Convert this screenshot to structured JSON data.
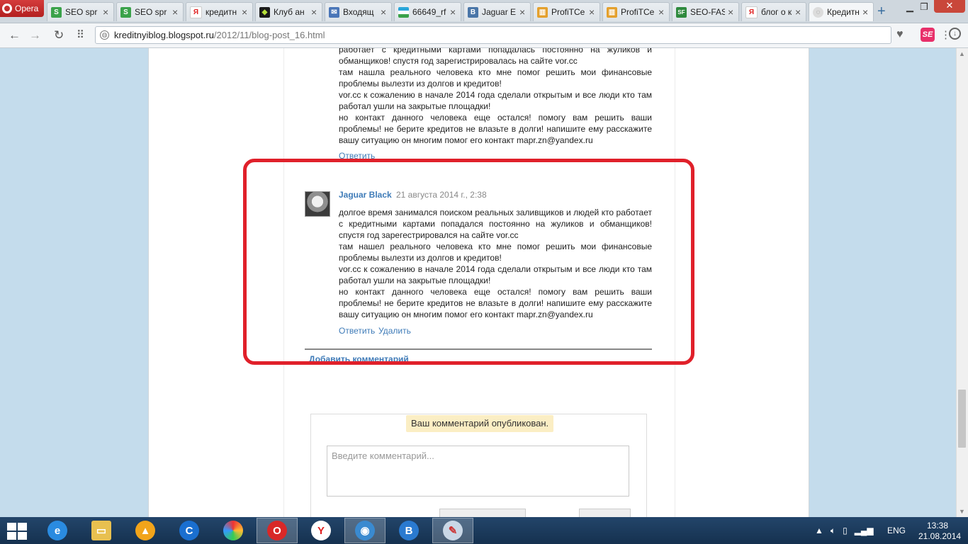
{
  "browser": {
    "menu_label": "Opera",
    "tabs": [
      {
        "label": "SEO spr",
        "icon": "seo-sprint-icon",
        "color": "#3aa24a",
        "glyph": "S"
      },
      {
        "label": "SEO spr",
        "icon": "seo-sprint-icon",
        "color": "#3aa24a",
        "glyph": "S"
      },
      {
        "label": "кредитн",
        "icon": "yandex-icon",
        "color": "#ffffff",
        "glyph": "Я"
      },
      {
        "label": "Клуб ан",
        "icon": "club-icon",
        "color": "#1a1a1a",
        "glyph": "◆"
      },
      {
        "label": "Входящ",
        "icon": "mail-icon",
        "color": "#4a76b8",
        "glyph": "✉"
      },
      {
        "label": "66649_rf",
        "icon": "uzbek-flag-icon",
        "color": "#2aa6d9",
        "glyph": "≡"
      },
      {
        "label": "Jaguar E",
        "icon": "vk-icon",
        "color": "#4a76a8",
        "glyph": "B"
      },
      {
        "label": "ProfiTCe",
        "icon": "profitcentr-icon",
        "color": "#e4a02d",
        "glyph": "▥"
      },
      {
        "label": "ProfiTCe",
        "icon": "profitcentr-icon",
        "color": "#e4a02d",
        "glyph": "▥"
      },
      {
        "label": "SEO-FAS",
        "icon": "seo-fast-icon",
        "color": "#2f8a3e",
        "glyph": "SF"
      },
      {
        "label": "блог о к",
        "icon": "yandex-icon",
        "color": "#ffffff",
        "glyph": "Я"
      },
      {
        "label": "Кредитн",
        "icon": "blogger-icon",
        "color": "#dcdcdc",
        "glyph": "◌"
      }
    ],
    "new_tab": "+",
    "url_host": "kreditnyiblog.blogspot.ru",
    "url_path": "/2012/11/blog-post_16.html"
  },
  "previous_comment": {
    "lines": [
      "работает с кредитными картами попадалась постоянно на жуликов и обманщиков! спустя год зарегистрировалась на сайте vor.cc",
      "там нашла реального человека кто мне помог решить мои финансовые проблемы вылезти из долгов и кредитов!",
      "vor.cc к сожалению в начале 2014 года сделали открытым и все люди кто там работал ушли на закрытые площадки!",
      "но контакт данного человека еще остался! помогу вам решить ваши проблемы! не берите кредитов не влазьте в долги! напишите ему расскажите вашу ситуацию он многим помог его контакт mapr.zn@yandex.ru"
    ],
    "reply": "Ответить"
  },
  "comment": {
    "author": "Jaguar Black",
    "date": "21 августа 2014 г., 2:38",
    "lines": [
      "долгое время занимался поиском реальных заливщиков и людей кто работает с кредитными картами попадался постоянно на жуликов и обманщиков! спустя год зарегестрировался на сайте vor.cc",
      "там нашел реального человека кто мне помог решить мои финансовые проблемы вылезти из долгов и кредитов!",
      "vor.cc к сожалению в начале 2014 года сделали открытым и все люди кто там работал ушли на закрытые площадки!",
      "но контакт данного человека еще остался! помогу вам решить ваши проблемы! не берите кредитов не влазьте в долги! напишите ему расскажите вашу ситуацию он многим помог его контакт mapr.zn@yandex.ru"
    ],
    "reply": "Ответить",
    "delete": "Удалить"
  },
  "add_comment": "Добавить комментарий",
  "form": {
    "notice": "Ваш комментарий опубликован.",
    "placeholder": "Введите комментарий..."
  },
  "taskbar": {
    "lang": "ENG",
    "time": "13:38",
    "date": "21.08.2014"
  },
  "colors": {
    "highlight": "#e0202a",
    "link": "#3e7bb8",
    "page_bg": "#c4dcec"
  }
}
